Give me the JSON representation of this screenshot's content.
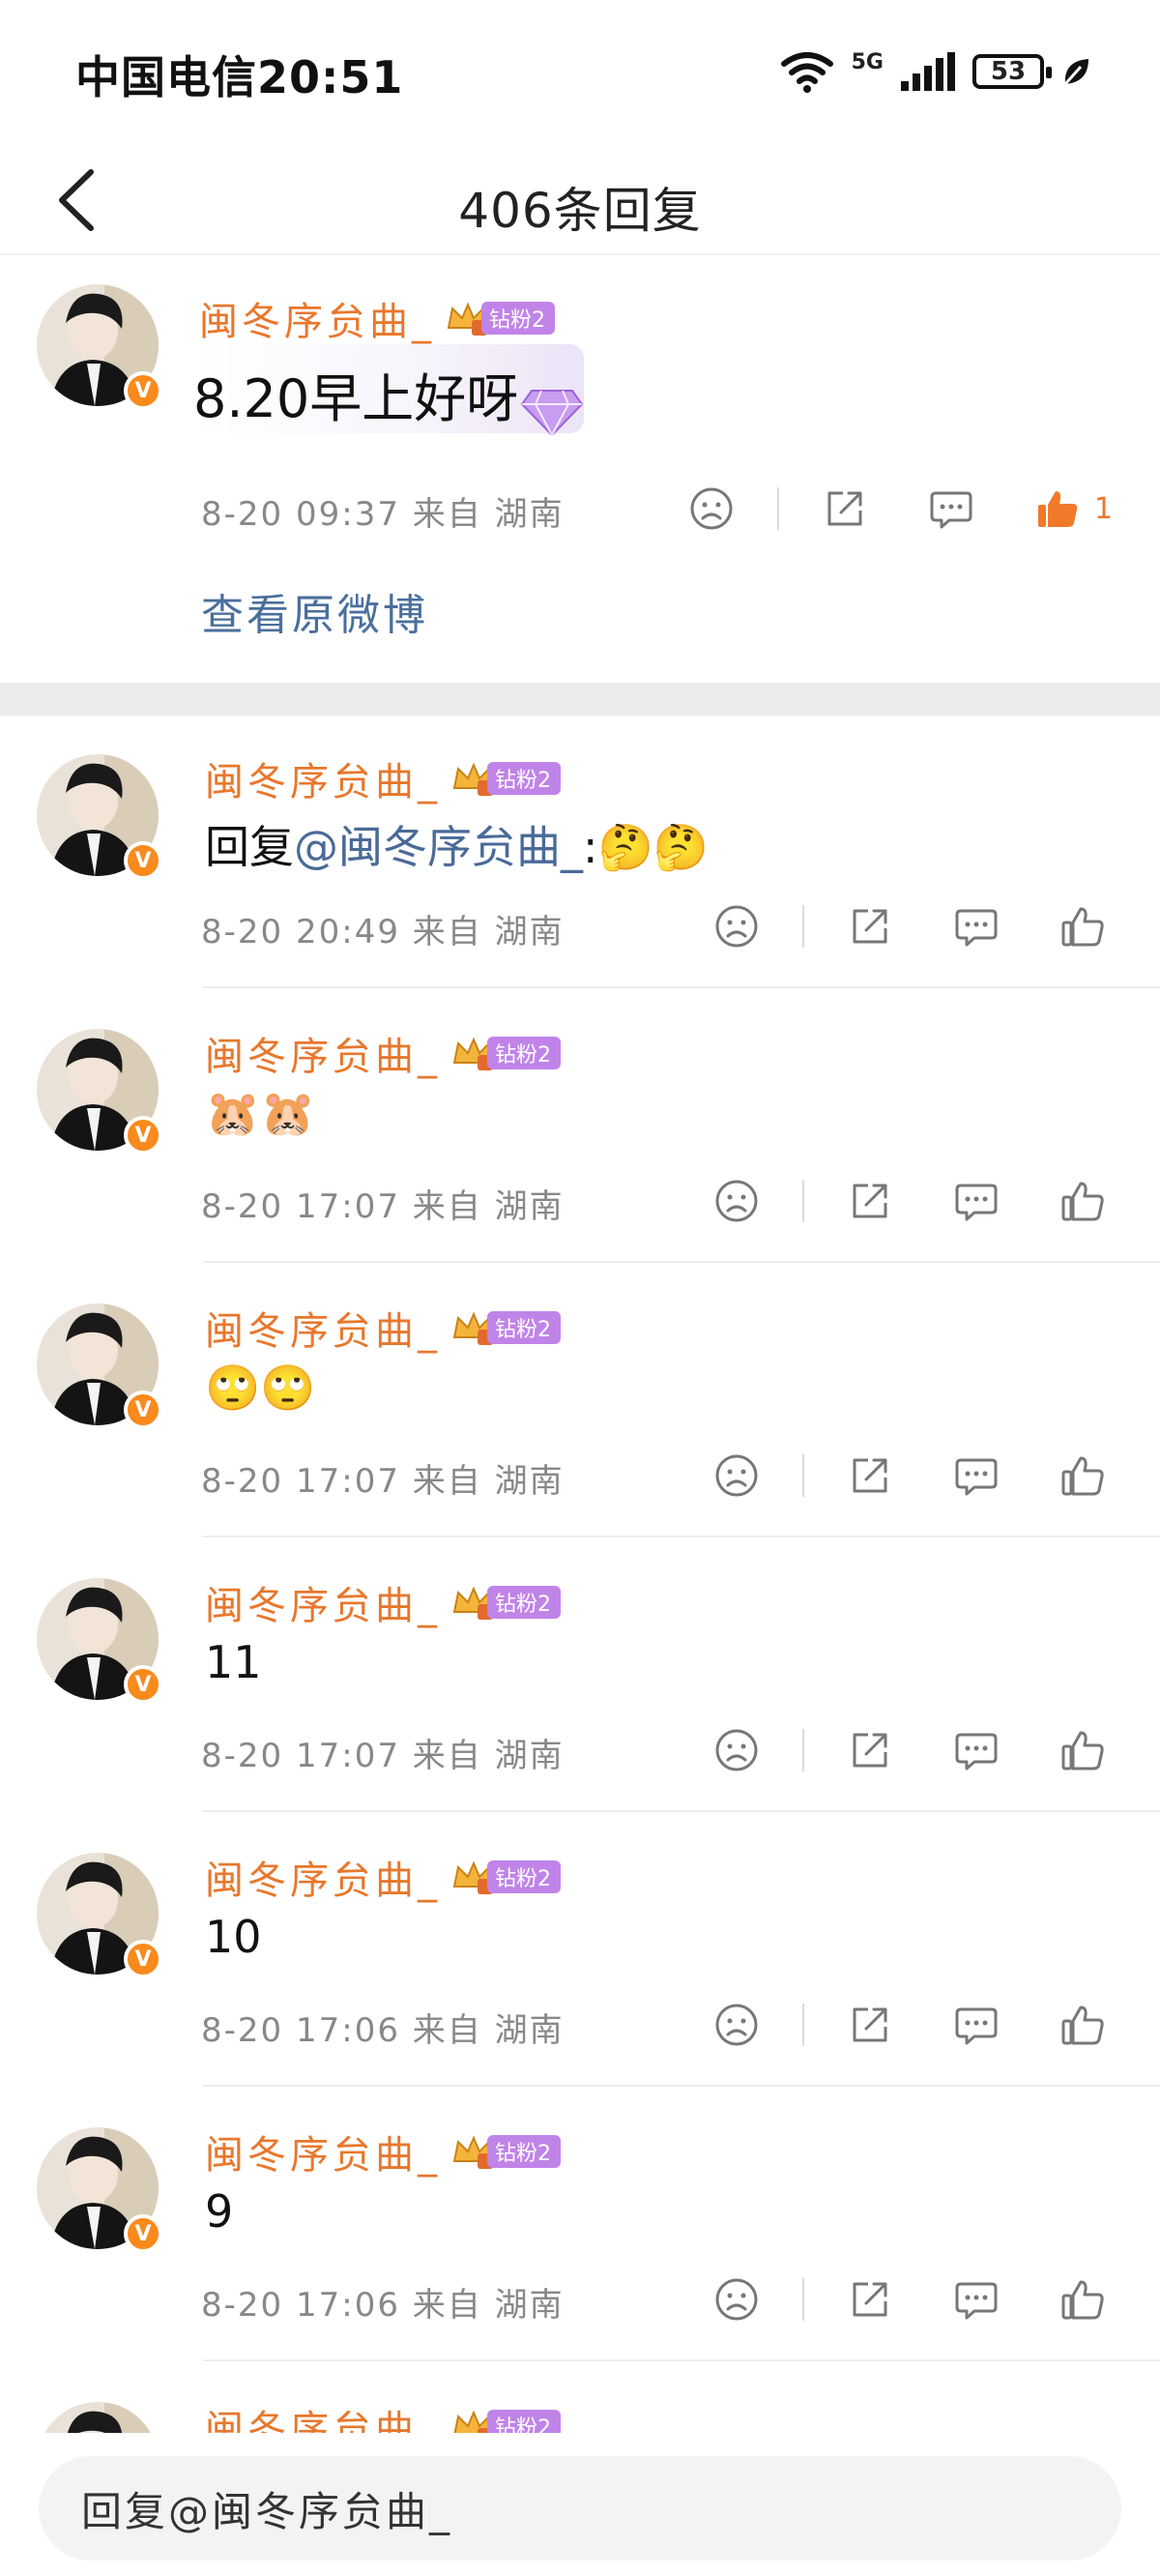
{
  "status_bar": {
    "carrier_time": "中国电信20:51",
    "network": "5G",
    "battery": "53"
  },
  "header": {
    "title": "406条回复"
  },
  "main_comment": {
    "username": "闽冬序贠曲_",
    "badge": "钻粉2",
    "content": "8.20早上好呀",
    "meta": "8-20 09:37 来自 湖南",
    "like_count": "1",
    "view_original": "查看原微博"
  },
  "replies": [
    {
      "username": "闽冬序贠曲_",
      "badge": "钻粉2",
      "prefix": "回复",
      "mention": "@闽冬序贠曲_",
      "content": ":🤔🤔",
      "meta": "8-20 20:49 来自 湖南"
    },
    {
      "username": "闽冬序贠曲_",
      "badge": "钻粉2",
      "content": "🐹🐹",
      "meta": "8-20 17:07 来自 湖南"
    },
    {
      "username": "闽冬序贠曲_",
      "badge": "钻粉2",
      "content": "🙄🙄",
      "meta": "8-20 17:07 来自 湖南"
    },
    {
      "username": "闽冬序贠曲_",
      "badge": "钻粉2",
      "content": "11",
      "meta": "8-20 17:07 来自 湖南"
    },
    {
      "username": "闽冬序贠曲_",
      "badge": "钻粉2",
      "content": "10",
      "meta": "8-20 17:06 来自 湖南"
    },
    {
      "username": "闽冬序贠曲_",
      "badge": "钻粉2",
      "content": "9",
      "meta": "8-20 17:06 来自 湖南"
    },
    {
      "username": "闽冬序贠曲_",
      "badge": "钻粉2"
    }
  ],
  "reply_bar": {
    "placeholder": "回复@闽冬序贠曲_"
  },
  "colors": {
    "username": "#e8772c",
    "mention": "#4a6a98",
    "link": "#4a6f9c",
    "badge": "#c084e8",
    "verified": "#f98a1b",
    "like_active": "#f07a2a"
  },
  "icons": [
    "back-arrow-icon",
    "wifi-icon",
    "signal-icon",
    "battery-icon",
    "leaf-icon",
    "dislike-face-icon",
    "share-icon",
    "comment-icon",
    "thumbs-up-icon",
    "verified-icon",
    "crown-badge-icon",
    "gem-icon"
  ]
}
